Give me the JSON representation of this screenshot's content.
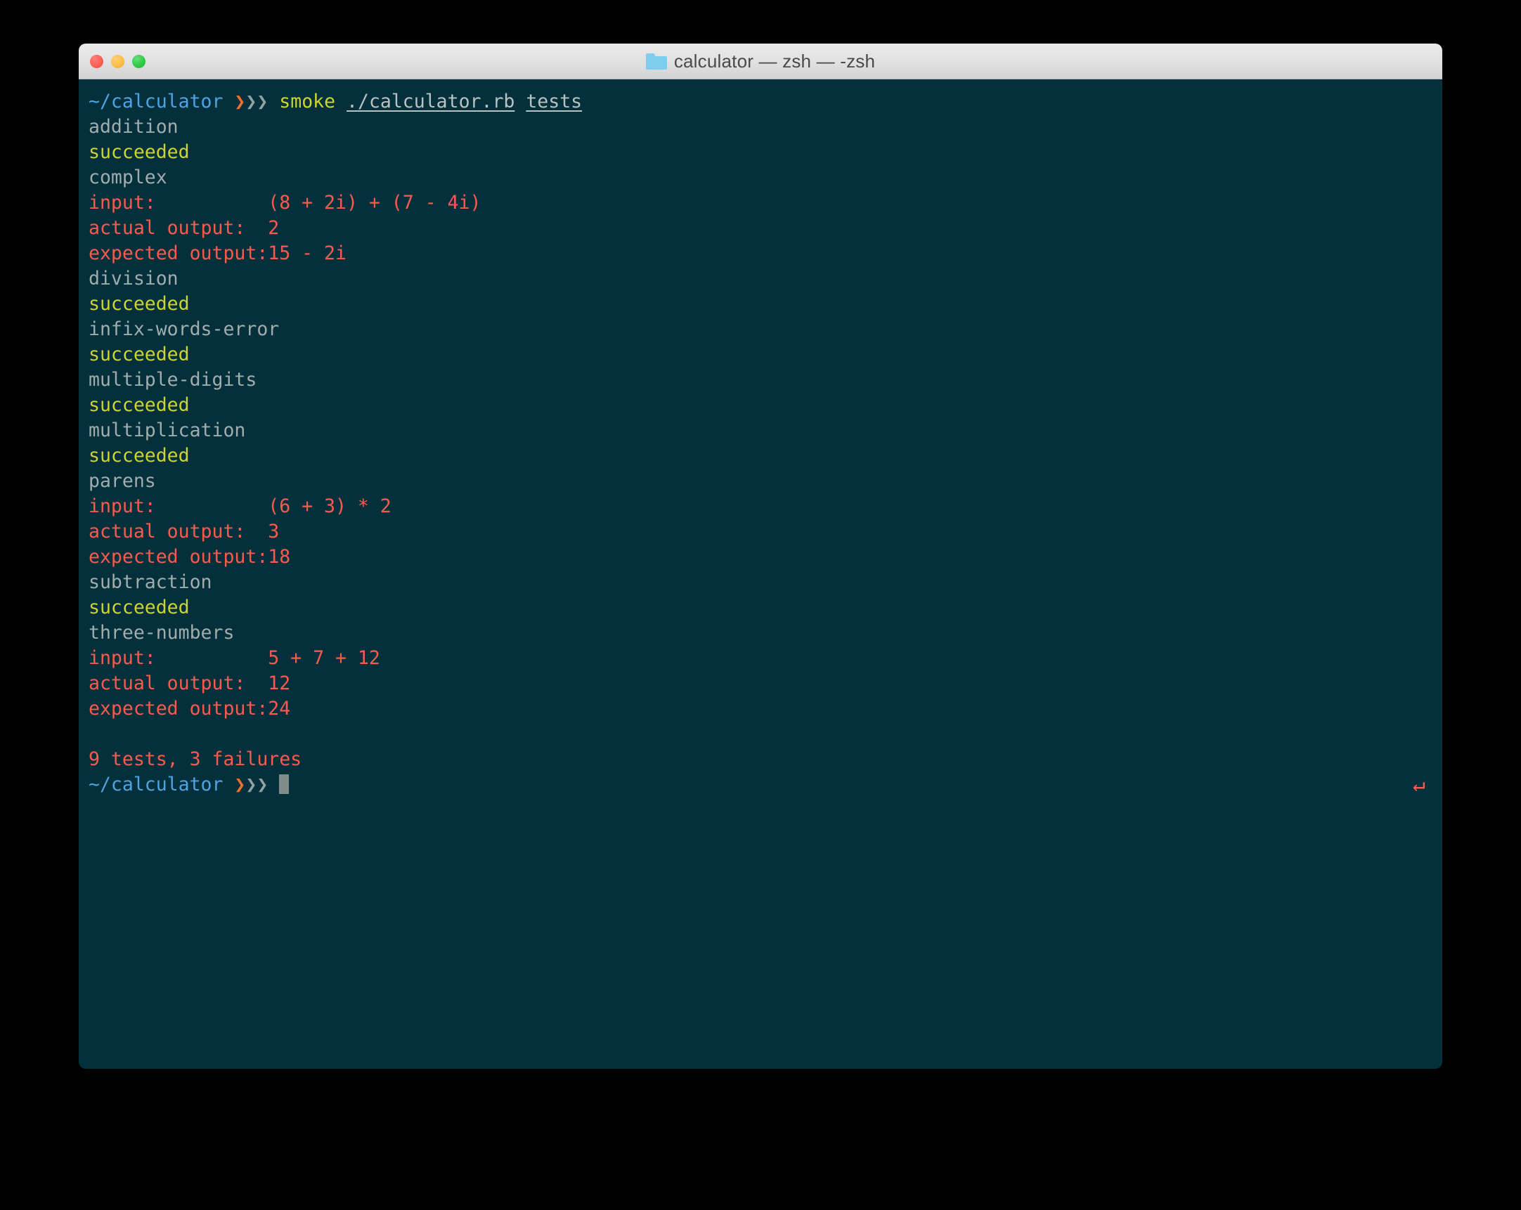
{
  "window": {
    "title": "calculator — zsh — -zsh",
    "folder_icon": "folder-icon",
    "traffic_lights": {
      "close": "close",
      "minimize": "minimize",
      "zoom": "zoom"
    },
    "colors": {
      "background": "#04303c",
      "titlebar": "#e2e2e2",
      "path": "#4fa3e3",
      "chevron_active": "#f4702a",
      "chevron_inactive": "#93a1a1",
      "command": "#cdd531",
      "argument": "#b7c2c2",
      "test_name": "#9fadad",
      "pass": "#cbd431",
      "fail": "#fc5a4e",
      "cursor": "#7e8c8c",
      "close_button": "#fb5d52",
      "minimize_button": "#fcbc40",
      "zoom_button": "#2fc840"
    }
  },
  "prompt": {
    "path": "~/calculator",
    "chevron_first": "❯",
    "chevron_rest": "❯❯",
    "command": "smoke",
    "arg1": "./calculator.rb",
    "arg2": "tests",
    "space": " ",
    "cursor": ""
  },
  "rprompt": {
    "glyph": "↵"
  },
  "labels": {
    "input": "input:",
    "actual": "actual output:",
    "expected": "expected output:",
    "succeeded": "succeeded"
  },
  "tests": [
    {
      "name": "addition",
      "status": "succeeded",
      "failed": false
    },
    {
      "name": "complex",
      "status": "failed",
      "failed": true,
      "input": "(8 + 2i) + (7 - 4i)",
      "actual": "2",
      "expected": "15 - 2i"
    },
    {
      "name": "division",
      "status": "succeeded",
      "failed": false
    },
    {
      "name": "infix-words-error",
      "status": "succeeded",
      "failed": false
    },
    {
      "name": "multiple-digits",
      "status": "succeeded",
      "failed": false
    },
    {
      "name": "multiplication",
      "status": "succeeded",
      "failed": false
    },
    {
      "name": "parens",
      "status": "failed",
      "failed": true,
      "input": "(6 + 3) * 2",
      "actual": "3",
      "expected": "18"
    },
    {
      "name": "subtraction",
      "status": "succeeded",
      "failed": false
    },
    {
      "name": "three-numbers",
      "status": "failed",
      "failed": true,
      "input": "5 + 7 + 12",
      "actual": "12",
      "expected": "24"
    }
  ],
  "summary": {
    "text": "9 tests, 3 failures",
    "total": 9,
    "failures": 3
  }
}
